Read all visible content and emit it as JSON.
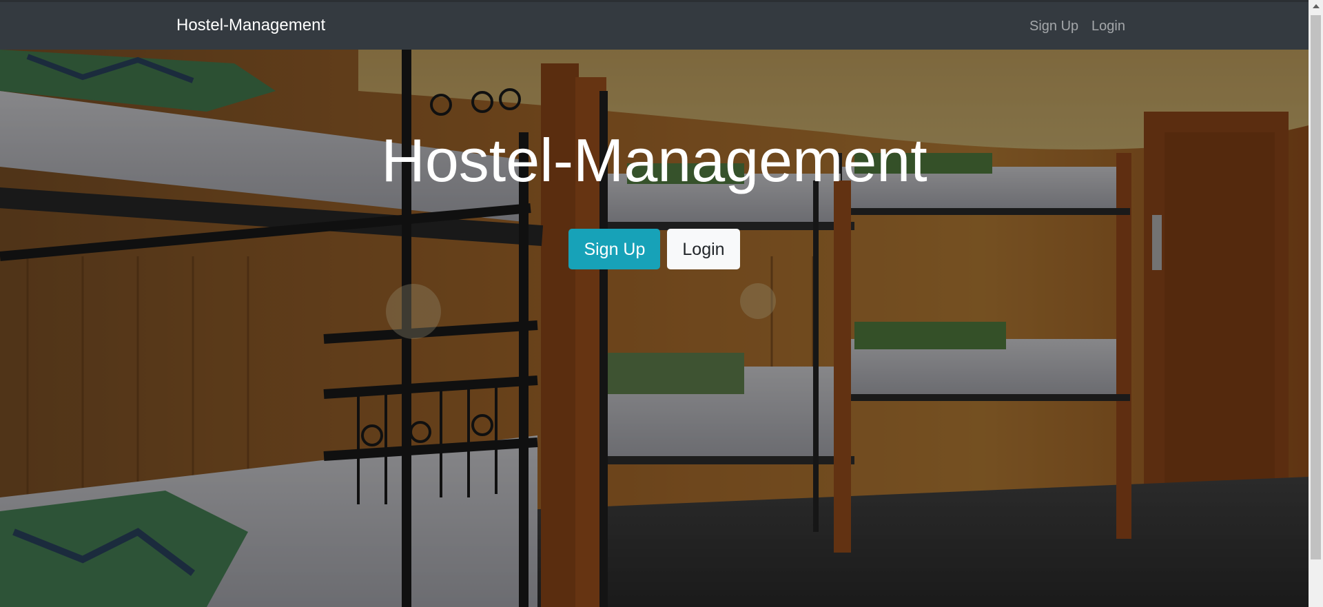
{
  "navbar": {
    "brand": "Hostel-Management",
    "links": {
      "signup": "Sign Up",
      "login": "Login"
    }
  },
  "hero": {
    "title": "Hostel-Management",
    "buttons": {
      "signup": "Sign Up",
      "login": "Login"
    }
  },
  "colors": {
    "navbar_bg": "#343a40",
    "primary_button": "#17a2b8",
    "light_button": "#f8f9fa"
  },
  "icons": {
    "scroll_up": "chevron-up-icon"
  }
}
